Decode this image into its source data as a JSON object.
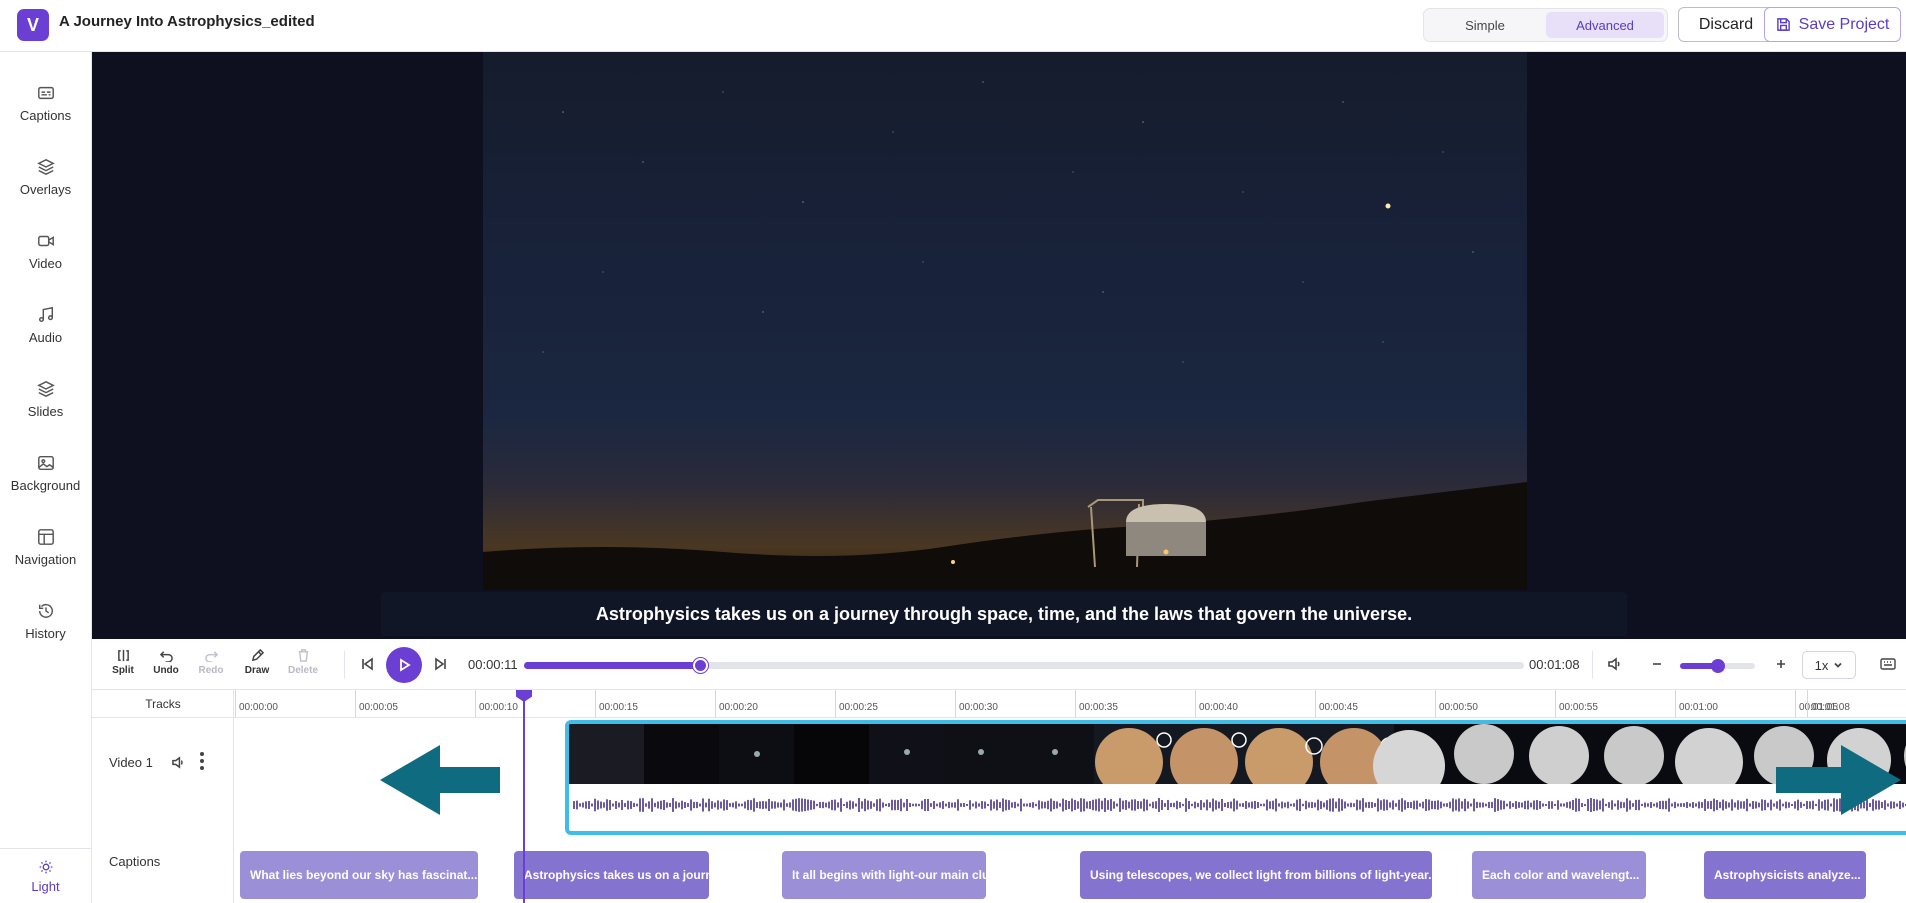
{
  "header": {
    "logo_letter": "V",
    "project_title": "A Journey Into Astrophysics_edited",
    "mode_simple": "Simple",
    "mode_advanced": "Advanced",
    "active_mode": "Advanced",
    "discard_label": "Discard",
    "save_label": "Save Project"
  },
  "sidebar": {
    "items": [
      {
        "label": "Captions",
        "icon": "captions-icon"
      },
      {
        "label": "Overlays",
        "icon": "layers-icon"
      },
      {
        "label": "Video",
        "icon": "video-camera-icon"
      },
      {
        "label": "Audio",
        "icon": "music-note-icon"
      },
      {
        "label": "Slides",
        "icon": "slides-icon"
      },
      {
        "label": "Background",
        "icon": "image-icon"
      },
      {
        "label": "Navigation",
        "icon": "layout-icon"
      },
      {
        "label": "History",
        "icon": "history-icon"
      }
    ],
    "theme_label": "Light",
    "theme_icon": "sun-icon"
  },
  "preview": {
    "caption": "Astrophysics takes us on a journey through space, time, and the laws that govern the universe."
  },
  "controls": {
    "tools": [
      {
        "label": "Split",
        "icon": "split-icon",
        "enabled": true
      },
      {
        "label": "Undo",
        "icon": "undo-icon",
        "enabled": true
      },
      {
        "label": "Redo",
        "icon": "redo-icon",
        "enabled": false
      },
      {
        "label": "Draw",
        "icon": "pencil-icon",
        "enabled": true
      },
      {
        "label": "Delete",
        "icon": "trash-icon",
        "enabled": false
      }
    ],
    "current_time": "00:00:11",
    "total_time": "00:01:08",
    "progress_fraction": 0.176,
    "zoom_fraction": 0.5,
    "speed": "1x"
  },
  "timeline": {
    "tracks_header": "Tracks",
    "video_track_label": "Video 1",
    "captions_track_label": "Captions",
    "ruler_ticks": [
      "00:00:00",
      "00:00:05",
      "00:00:10",
      "00:00:15",
      "00:00:20",
      "00:00:25",
      "00:00:30",
      "00:00:35",
      "00:00:40",
      "00:00:45",
      "00:00:50",
      "00:00:55",
      "00:01:00",
      "00:01:05",
      "00:01:08"
    ],
    "caption_chips": [
      "What lies beyond our sky has fascinat...",
      "Astrophysics takes us on a journey ...",
      "It all begins with light-our main clue to unde...",
      "Using telescopes, we collect light from billions of light-year...",
      "Each color and wavelengt...",
      "Astrophysicists analyze..."
    ],
    "clip_selected_color": "#3fbde6"
  },
  "colors": {
    "accent": "#6b3fd4",
    "annotation_arrow": "#0e6b80"
  }
}
